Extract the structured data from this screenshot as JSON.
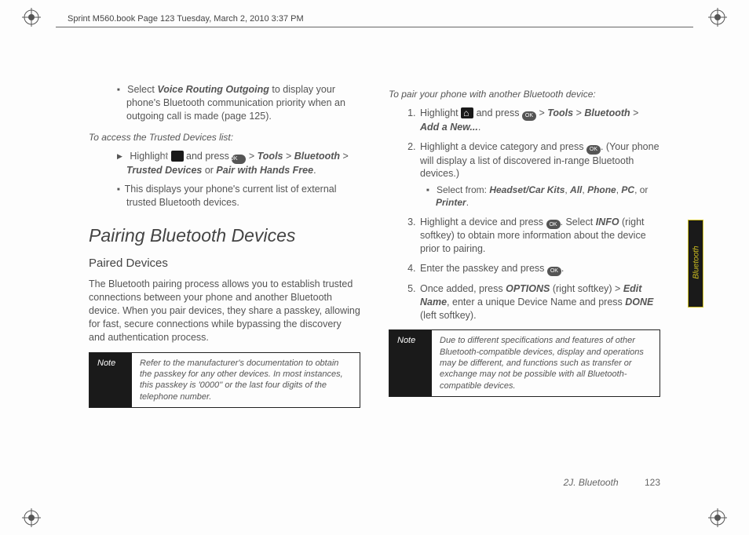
{
  "header": {
    "text": "Sprint M560.book  Page 123  Tuesday, March 2, 2010  3:37 PM"
  },
  "sideTab": {
    "label": "Bluetooth"
  },
  "footer": {
    "section": "2J. Bluetooth",
    "page": "123"
  },
  "left": {
    "bullet1_prefix": "Select ",
    "bullet1_em": "Voice Routing Outgoing",
    "bullet1_suffix": " to display your phone's Bluetooth communication priority when an outgoing call is made (page 125).",
    "sub1": "To access the Trusted Devices list:",
    "step1a": "Highlight ",
    "step1b": " and press ",
    "step1c": " > ",
    "step1_tools": "Tools",
    "step1_bt": "Bluetooth",
    "step1_td": "Trusted Devices",
    "step1_or": " or ",
    "step1_pair": "Pair with Hands Free",
    "step1_end": ".",
    "bullet2": "This displays your phone's current list of external trusted Bluetooth devices.",
    "h1": "Pairing Bluetooth Devices",
    "h2": "Paired Devices",
    "para": "The Bluetooth pairing process allows you to establish trusted connections between your phone and another Bluetooth device. When you pair devices, they share a passkey, allowing for fast, secure connections while bypassing the discovery and authentication process.",
    "noteLabel": "Note",
    "noteText": "Refer to the manufacturer's documentation to obtain the passkey for any other devices. In most instances, this passkey is '0000'' or the last four digits of the telephone number."
  },
  "right": {
    "sub1": "To pair your phone with another Bluetooth device:",
    "s1a": "Highlight ",
    "s1b": " and press ",
    "s1_tools": "Tools",
    "s1_bt": "Bluetooth",
    "s1_add": "Add a New...",
    "s2a": "Highlight a device category and press ",
    "s2b": ". (Your phone will display a list of discovered in-range Bluetooth devices.)",
    "s2_sel": "Select from: ",
    "s2_opt1": "Headset/Car Kits",
    "s2_opt2": "All",
    "s2_opt3": "Phone",
    "s2_opt4": "PC",
    "s2_or": ", or ",
    "s2_opt5": "Printer",
    "s3a": "Highlight a device and press ",
    "s3b": ". Select ",
    "s3_info": "INFO",
    "s3c": " (right softkey) to obtain more information about the device prior to pairing.",
    "s4a": "Enter the passkey and press ",
    "s4b": ".",
    "s5a": "Once added, press ",
    "s5_opt": "OPTIONS",
    "s5b": " (right softkey) > ",
    "s5_edit": "Edit Name",
    "s5c": ", enter a unique Device Name and press ",
    "s5_done": "DONE",
    "s5d": " (left softkey).",
    "noteLabel": "Note",
    "noteText": "Due to different specifications and features of other Bluetooth-compatible devices, display and operations may be different, and functions such as transfer or exchange may not be possible with all Bluetooth-compatible devices."
  }
}
